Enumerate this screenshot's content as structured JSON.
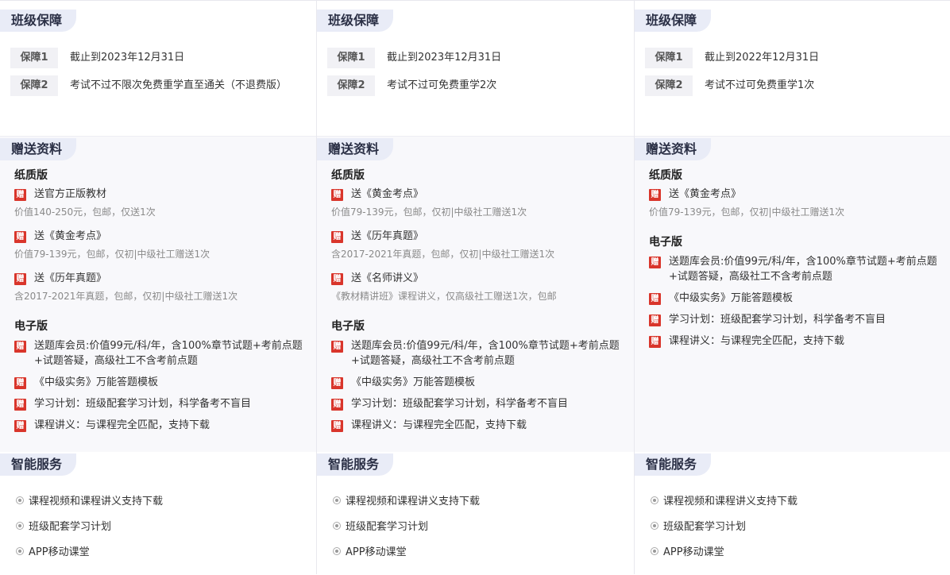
{
  "columns": [
    {
      "guarantee": {
        "title": "班级保障",
        "items": [
          {
            "badge": "保障1",
            "text": "截止到2023年12月31日"
          },
          {
            "badge": "保障2",
            "text": "考试不过不限次免费重学直至通关（不退费版）"
          }
        ]
      },
      "gifts": {
        "title": "赠送资料",
        "paper_title": "纸质版",
        "paper": [
          {
            "text": "送官方正版教材",
            "desc": "价值140-250元，包邮，仅送1次"
          },
          {
            "text": "送《黄金考点》",
            "desc": "价值79-139元，包邮，仅初|中级社工赠送1次"
          },
          {
            "text": "送《历年真题》",
            "desc": "含2017-2021年真题，包邮，仅初|中级社工赠送1次"
          }
        ],
        "digital_title": "电子版",
        "digital": [
          "送题库会员:价值99元/科/年，含100%章节试题+考前点题+试题答疑，高级社工不含考前点题",
          "《中级实务》万能答题模板",
          "学习计划：班级配套学习计划，科学备考不盲目",
          "课程讲义：与课程完全匹配，支持下载"
        ]
      },
      "services": {
        "title": "智能服务",
        "items": [
          "课程视频和课程讲义支持下载",
          "班级配套学习计划",
          "APP移动课堂"
        ]
      }
    },
    {
      "guarantee": {
        "title": "班级保障",
        "items": [
          {
            "badge": "保障1",
            "text": "截止到2023年12月31日"
          },
          {
            "badge": "保障2",
            "text": "考试不过可免费重学2次"
          }
        ]
      },
      "gifts": {
        "title": "赠送资料",
        "paper_title": "纸质版",
        "paper": [
          {
            "text": "送《黄金考点》",
            "desc": "价值79-139元，包邮，仅初|中级社工赠送1次"
          },
          {
            "text": "送《历年真题》",
            "desc": "含2017-2021年真题，包邮，仅初|中级社工赠送1次"
          },
          {
            "text": "送《名师讲义》",
            "desc": "《教材精讲班》课程讲义，仅高级社工赠送1次，包邮"
          }
        ],
        "digital_title": "电子版",
        "digital": [
          "送题库会员:价值99元/科/年，含100%章节试题+考前点题+试题答疑，高级社工不含考前点题",
          "《中级实务》万能答题模板",
          "学习计划：班级配套学习计划，科学备考不盲目",
          "课程讲义：与课程完全匹配，支持下载"
        ]
      },
      "services": {
        "title": "智能服务",
        "items": [
          "课程视频和课程讲义支持下载",
          "班级配套学习计划",
          "APP移动课堂"
        ]
      }
    },
    {
      "guarantee": {
        "title": "班级保障",
        "items": [
          {
            "badge": "保障1",
            "text": "截止到2022年12月31日"
          },
          {
            "badge": "保障2",
            "text": "考试不过可免费重学1次"
          }
        ]
      },
      "gifts": {
        "title": "赠送资料",
        "paper_title": "纸质版",
        "paper": [
          {
            "text": "送《黄金考点》",
            "desc": "价值79-139元，包邮，仅初|中级社工赠送1次"
          }
        ],
        "digital_title": "电子版",
        "digital": [
          "送题库会员:价值99元/科/年，含100%章节试题+考前点题+试题答疑，高级社工不含考前点题",
          "《中级实务》万能答题模板",
          "学习计划：班级配套学习计划，科学备考不盲目",
          "课程讲义：与课程完全匹配，支持下载"
        ]
      },
      "services": {
        "title": "智能服务",
        "items": [
          "课程视频和课程讲义支持下载",
          "班级配套学习计划",
          "APP移动课堂"
        ]
      }
    }
  ],
  "gift_badge_char": "赠",
  "colors": {
    "gift_badge": "#d9352b",
    "tag_bg": "#e9ecf7",
    "section_bg": "#f8f8fb"
  }
}
